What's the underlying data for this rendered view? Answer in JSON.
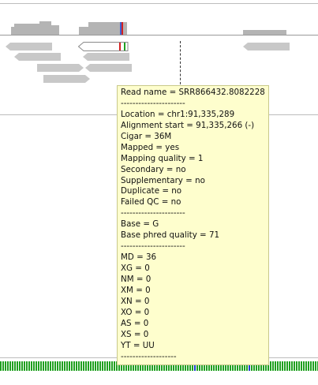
{
  "popup": {
    "read_name": "Read name = SRR866432.8082228",
    "sep1": "----------------------",
    "location": "Location = chr1:91,335,289",
    "alignment_start": "Alignment start = 91,335,266 (-)",
    "cigar": "Cigar = 36M",
    "mapped": "Mapped = yes",
    "mapping_quality": "Mapping quality = 1",
    "secondary": "Secondary = no",
    "supplementary": "Supplementary = no",
    "duplicate": "Duplicate = no",
    "failed_qc": "Failed QC = no",
    "sep2": "----------------------",
    "base": "Base = G",
    "base_phred_quality": "Base phred quality = 71",
    "sep3": "----------------------",
    "md": "MD = 36",
    "xg": "XG = 0",
    "nm": "NM = 0",
    "xm": "XM = 0",
    "xn": "XN = 0",
    "xo": "XO = 0",
    "as": "AS = 0",
    "xs": "XS = 0",
    "yt": "YT = UU",
    "sep4": "-------------------"
  },
  "colors": {
    "read_gray": "#c8c8c8",
    "coverage_gray": "#b4b4b4",
    "popup_bg": "#fefecd",
    "mismatch_red": "#d42020",
    "mismatch_green": "#20a020",
    "base_A": "#20a020",
    "base_C": "#2040d0",
    "base_G": "#d08000",
    "base_T": "#d42020"
  }
}
